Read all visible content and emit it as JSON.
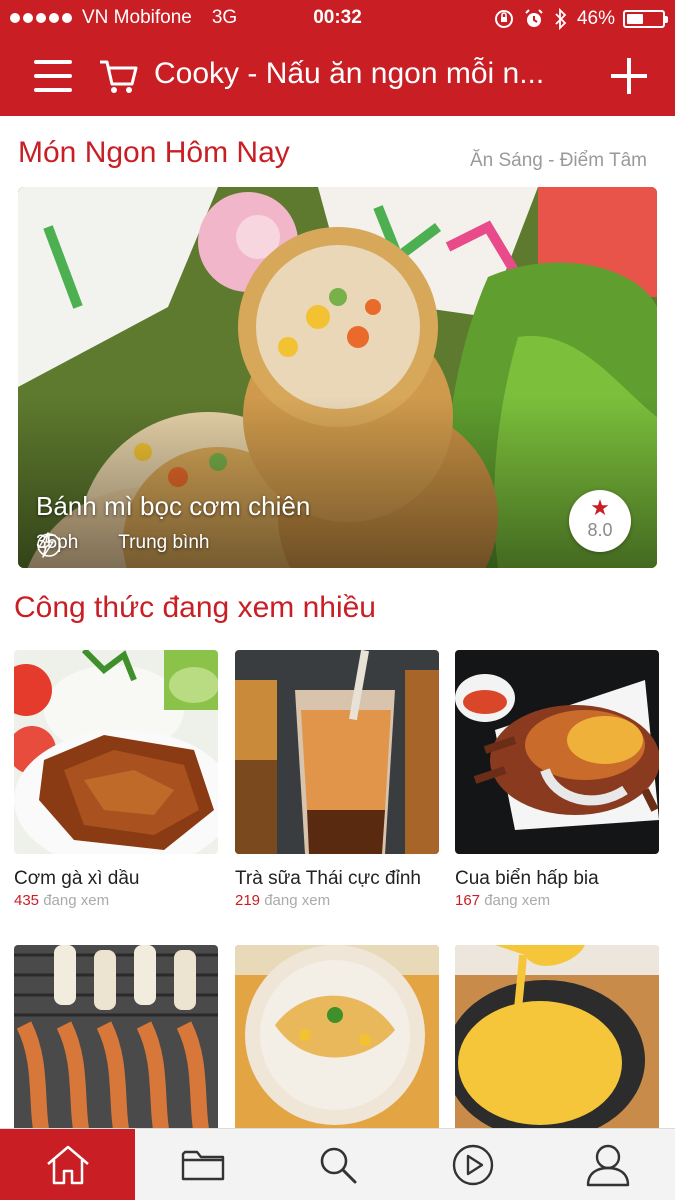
{
  "status": {
    "carrier": "VN Mobifone",
    "network": "3G",
    "time": "00:32",
    "battery": "46%",
    "battery_level": 0.46
  },
  "nav": {
    "title": "Cooky - Nấu ăn ngon mỗi n..."
  },
  "today": {
    "heading": "Món Ngon Hôm Nay",
    "category": "Ăn Sáng - Điểm Tâm",
    "featured": {
      "title": "Bánh mì bọc cơm chiên",
      "time": "35ph",
      "difficulty": "Trung bình",
      "rating": "8.0"
    }
  },
  "popular": {
    "heading": "Công thức đang xem nhiều",
    "viewing_label": "đang xem",
    "items": [
      {
        "name": "Cơm gà xì dầu",
        "views": "435"
      },
      {
        "name": "Trà sữa Thái cực đỉnh",
        "views": "219"
      },
      {
        "name": "Cua biển hấp bia",
        "views": "167"
      },
      {
        "name": "",
        "views": ""
      },
      {
        "name": "",
        "views": ""
      },
      {
        "name": "",
        "views": ""
      }
    ]
  },
  "tabs": [
    {
      "icon": "home-icon",
      "active": true
    },
    {
      "icon": "folder-icon",
      "active": false
    },
    {
      "icon": "search-icon",
      "active": false
    },
    {
      "icon": "play-icon",
      "active": false
    },
    {
      "icon": "user-icon",
      "active": false
    }
  ],
  "colors": {
    "brand": "#c81e24",
    "muted": "#9a9a9a"
  }
}
